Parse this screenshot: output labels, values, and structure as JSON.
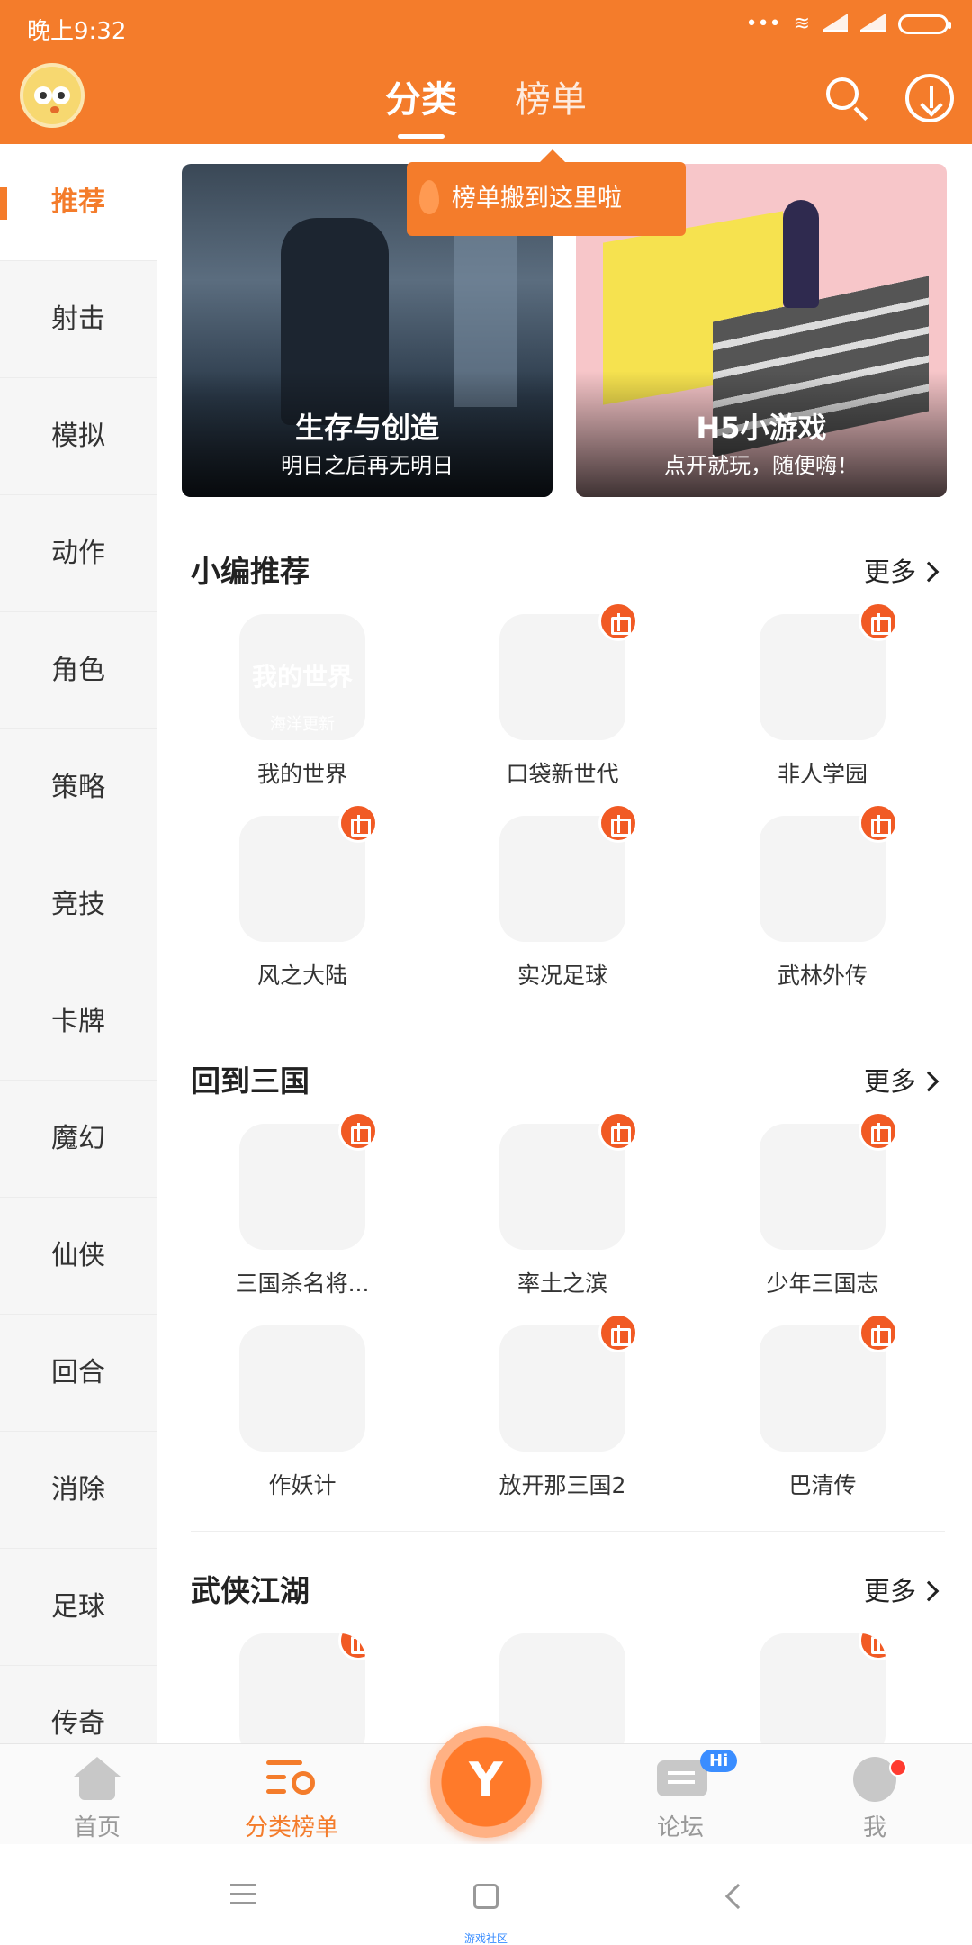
{
  "status": {
    "time": "晚上9:32"
  },
  "header": {
    "tabs": [
      {
        "label": "分类",
        "active": true
      },
      {
        "label": "榜单",
        "active": false
      }
    ],
    "tooltip": "榜单搬到这里啦"
  },
  "sidebar": {
    "items": [
      {
        "label": "推荐",
        "active": true
      },
      {
        "label": "射击"
      },
      {
        "label": "模拟"
      },
      {
        "label": "动作"
      },
      {
        "label": "角色"
      },
      {
        "label": "策略"
      },
      {
        "label": "竞技"
      },
      {
        "label": "卡牌"
      },
      {
        "label": "魔幻"
      },
      {
        "label": "仙侠"
      },
      {
        "label": "回合"
      },
      {
        "label": "消除"
      },
      {
        "label": "足球"
      },
      {
        "label": "传奇"
      }
    ]
  },
  "banners": [
    {
      "title": "生存与创造",
      "subtitle": "明日之后再无明日"
    },
    {
      "title": "H5小游戏",
      "subtitle": "点开就玩，随便嗨！"
    }
  ],
  "sections": [
    {
      "title": "小编推荐",
      "more": "更多",
      "games": [
        {
          "name": "我的世界",
          "gift": false,
          "icon_text": "我的世界",
          "icon_sub": "海洋更新"
        },
        {
          "name": "口袋新世代",
          "gift": true
        },
        {
          "name": "非人学园",
          "gift": true
        },
        {
          "name": "风之大陆",
          "gift": true
        },
        {
          "name": "实况足球",
          "gift": true
        },
        {
          "name": "武林外传",
          "gift": true
        }
      ]
    },
    {
      "title": "回到三国",
      "more": "更多",
      "games": [
        {
          "name": "三国杀名将...",
          "gift": true
        },
        {
          "name": "率土之滨",
          "gift": true
        },
        {
          "name": "少年三国志",
          "gift": true
        },
        {
          "name": "作妖计",
          "gift": false
        },
        {
          "name": "放开那三国2",
          "gift": true
        },
        {
          "name": "巴清传",
          "gift": true
        }
      ]
    },
    {
      "title": "武侠江湖",
      "more": "更多"
    }
  ],
  "bottom_nav": [
    {
      "label": "首页",
      "icon": "home-icon"
    },
    {
      "label": "分类榜单",
      "icon": "category-rank-icon",
      "active": true
    },
    {
      "label": "",
      "icon": "center-logo-icon"
    },
    {
      "label": "论坛",
      "icon": "forum-icon",
      "badge": "Hi"
    },
    {
      "label": "我",
      "icon": "profile-icon"
    }
  ],
  "system_nav": {
    "label": "游戏社区"
  },
  "colors": {
    "brand": "#f47c2b",
    "gift": "#f15a24",
    "badge": "#3a8dff"
  }
}
